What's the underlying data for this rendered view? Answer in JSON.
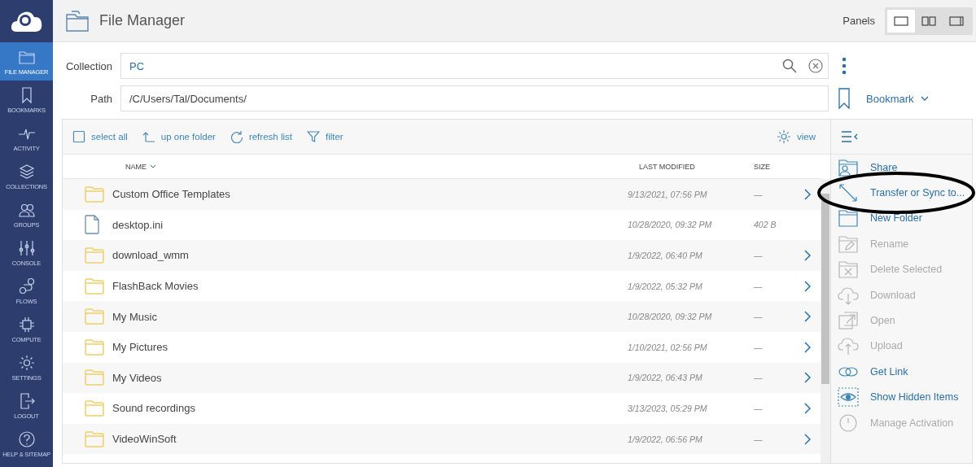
{
  "sidebar": {
    "items": [
      {
        "label": "FILE MANAGER",
        "selected": true
      },
      {
        "label": "BOOKMARKS",
        "selected": false
      },
      {
        "label": "ACTIVITY",
        "selected": false
      },
      {
        "label": "COLLECTIONS",
        "selected": false
      },
      {
        "label": "GROUPS",
        "selected": false
      },
      {
        "label": "CONSOLE",
        "selected": false
      },
      {
        "label": "FLOWS",
        "selected": false
      },
      {
        "label": "COMPUTE",
        "selected": false
      },
      {
        "label": "SETTINGS",
        "selected": false
      },
      {
        "label": "LOGOUT",
        "selected": false
      },
      {
        "label": "HELP & SITEMAP",
        "selected": false
      }
    ]
  },
  "header": {
    "title": "File Manager",
    "panels_label": "Panels",
    "panels": [
      {
        "selected": true
      },
      {
        "selected": false
      },
      {
        "selected": false
      }
    ]
  },
  "collection": {
    "label": "Collection",
    "value": "PC"
  },
  "path": {
    "label": "Path",
    "value": "/C/Users/Tal/Documents/",
    "bookmark": "Bookmark"
  },
  "select_all": {
    "label": "select all",
    "checked": false
  },
  "toolbar": [
    "up one folder",
    "refresh list",
    "filter"
  ],
  "view_button": "view",
  "table": {
    "columns": [
      "NAME",
      "LAST MODIFIED",
      "SIZE"
    ],
    "rows": [
      {
        "kind": "folder",
        "name": "Custom Office Templates",
        "modified": "9/13/2021, 07:56 PM",
        "size": "—"
      },
      {
        "kind": "file",
        "name": "desktop.ini",
        "modified": "10/28/2020, 09:32 PM",
        "size": "402 B"
      },
      {
        "kind": "folder",
        "name": "download_wmm",
        "modified": "1/9/2022, 06:40 PM",
        "size": "—"
      },
      {
        "kind": "folder",
        "name": "FlashBack Movies",
        "modified": "1/9/2022, 05:32 PM",
        "size": "—"
      },
      {
        "kind": "folder",
        "name": "My Music",
        "modified": "10/28/2020, 09:32 PM",
        "size": "—"
      },
      {
        "kind": "folder",
        "name": "My Pictures",
        "modified": "1/10/2021, 02:56 PM",
        "size": "—"
      },
      {
        "kind": "folder",
        "name": "My Videos",
        "modified": "1/9/2022, 06:43 PM",
        "size": "—"
      },
      {
        "kind": "folder",
        "name": "Sound recordings",
        "modified": "3/13/2023, 05:29 PM",
        "size": "—"
      },
      {
        "kind": "folder",
        "name": "VideoWinSoft",
        "modified": "1/9/2022, 06:56 PM",
        "size": "—"
      }
    ]
  },
  "actions": [
    {
      "label": "Share",
      "disabled": false,
      "highlighted": false
    },
    {
      "label": "Transfer or Sync to...",
      "disabled": false,
      "highlighted": true
    },
    {
      "label": "New Folder",
      "disabled": false,
      "highlighted": false
    },
    {
      "label": "Rename",
      "disabled": true,
      "highlighted": false
    },
    {
      "label": "Delete Selected",
      "disabled": true,
      "highlighted": false
    },
    {
      "label": "Download",
      "disabled": true,
      "highlighted": false
    },
    {
      "label": "Open",
      "disabled": true,
      "highlighted": false
    },
    {
      "label": "Upload",
      "disabled": true,
      "highlighted": false
    },
    {
      "label": "Get Link",
      "disabled": false,
      "highlighted": false
    },
    {
      "label": "Show Hidden Items",
      "disabled": false,
      "highlighted": false
    },
    {
      "label": "Manage Activation",
      "disabled": true,
      "highlighted": false
    }
  ]
}
